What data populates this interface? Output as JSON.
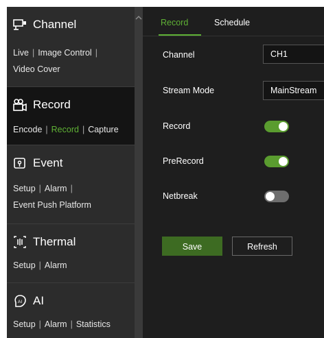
{
  "sidebar": {
    "sections": [
      {
        "title": "Channel",
        "icon": "channel-icon",
        "links": [
          {
            "label": "Live"
          },
          {
            "label": "Image Control"
          },
          {
            "label": "Video Cover"
          }
        ]
      },
      {
        "title": "Record",
        "icon": "record-icon",
        "links": [
          {
            "label": "Encode"
          },
          {
            "label": "Record",
            "active": true
          },
          {
            "label": "Capture"
          }
        ]
      },
      {
        "title": "Event",
        "icon": "event-icon",
        "links": [
          {
            "label": "Setup"
          },
          {
            "label": "Alarm"
          },
          {
            "label": "Event Push Platform"
          }
        ]
      },
      {
        "title": "Thermal",
        "icon": "thermal-icon",
        "links": [
          {
            "label": "Setup"
          },
          {
            "label": "Alarm"
          }
        ]
      },
      {
        "title": "AI",
        "icon": "ai-icon",
        "links": [
          {
            "label": "Setup"
          },
          {
            "label": "Alarm"
          },
          {
            "label": "Statistics"
          }
        ]
      }
    ],
    "separator": "|"
  },
  "tabs": [
    {
      "label": "Record",
      "active": true
    },
    {
      "label": "Schedule",
      "active": false
    }
  ],
  "form": {
    "channel": {
      "label": "Channel",
      "value": "CH1"
    },
    "stream_mode": {
      "label": "Stream Mode",
      "value": "MainStream"
    },
    "record": {
      "label": "Record",
      "on": true
    },
    "prerecord": {
      "label": "PreRecord",
      "on": true
    },
    "netbreak": {
      "label": "Netbreak",
      "on": false
    }
  },
  "buttons": {
    "save": "Save",
    "refresh": "Refresh"
  },
  "colors": {
    "accent": "#5fb135",
    "toggle_on": "#5a9c2f",
    "toggle_off": "#6e6e6e",
    "save_bg": "#3d6b22"
  }
}
